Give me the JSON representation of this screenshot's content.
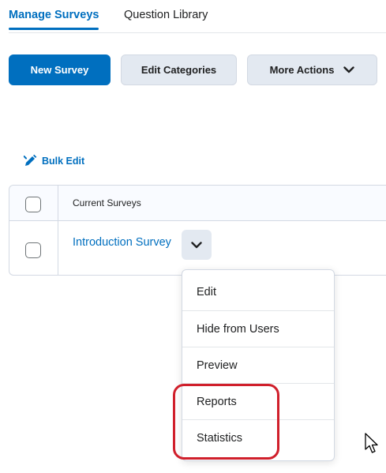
{
  "tabs": [
    {
      "label": "Manage Surveys"
    },
    {
      "label": "Question Library"
    }
  ],
  "toolbar": {
    "new_survey": "New Survey",
    "edit_categories": "Edit Categories",
    "more_actions": "More Actions"
  },
  "bulk_edit": "Bulk Edit",
  "table": {
    "header": "Current Surveys",
    "rows": [
      {
        "title": "Introduction Survey"
      }
    ]
  },
  "context_menu": {
    "items": [
      {
        "label": "Edit"
      },
      {
        "label": "Hide from Users"
      },
      {
        "label": "Preview"
      },
      {
        "label": "Reports"
      },
      {
        "label": "Statistics"
      }
    ]
  },
  "colors": {
    "primary": "#006fbf",
    "highlight": "#d01f2b",
    "secondary_bg": "#e3e9f1"
  },
  "icons": {
    "bulk_edit": "pencil-icon",
    "chevron": "chevron-down-icon",
    "cursor": "mouse-pointer-icon"
  }
}
